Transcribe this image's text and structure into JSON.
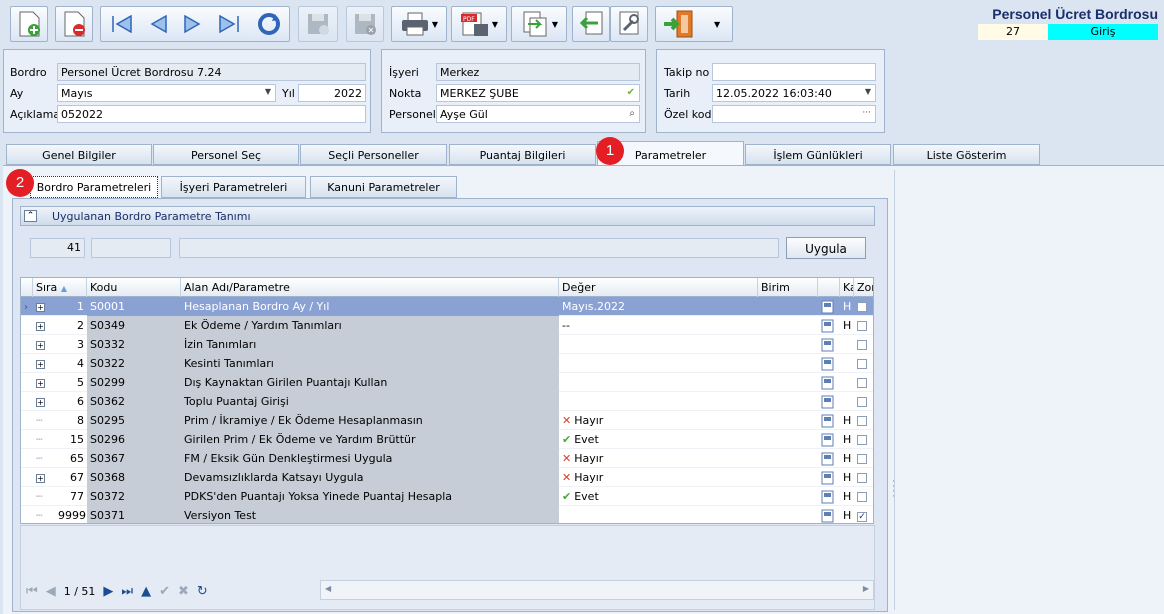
{
  "header": {
    "title": "Personel Ücret Bordrosu",
    "code": "27",
    "state": "Giriş"
  },
  "toolbar": {
    "buttons": [
      "new-icon",
      "delete-icon",
      "first-icon",
      "prev-icon",
      "next-icon",
      "last-icon",
      "refresh-icon",
      "save-icon",
      "cancel-save-icon",
      "print-icon",
      "pdf-icon",
      "export-icon",
      "import-icon",
      "tools-icon",
      "exit-icon"
    ]
  },
  "form": {
    "bordro_label": "Bordro",
    "bordro_value": "Personel Ücret Bordrosu 7.24",
    "ay_label": "Ay",
    "ay_value": "Mayıs",
    "yil_label": "Yıl",
    "yil_value": "2022",
    "aciklama_label": "Açıklama",
    "aciklama_value": "052022",
    "isyeri_label": "İşyeri",
    "isyeri_value": "Merkez",
    "nokta_label": "Nokta",
    "nokta_value": "MERKEZ ŞUBE",
    "personel_label": "Personel",
    "personel_value": "Ayşe Gül",
    "takip_label": "Takip no",
    "takip_value": "",
    "tarih_label": "Tarih",
    "tarih_value": "12.05.2022 16:03:40",
    "ozel_label": "Özel kod",
    "ozel_value": "",
    "ellipsis": "···"
  },
  "tabs": [
    "Genel Bilgiler",
    "Personel Seç",
    "Seçli Personeller",
    "Puantaj Bilgileri",
    "Parametreler",
    "İşlem Günlükleri",
    "Liste Gösterim"
  ],
  "subtabs": [
    "Bordro Parametreleri",
    "İşyeri Parametreleri",
    "Kanuni Parametreler"
  ],
  "badges": [
    "1",
    "2"
  ],
  "group": {
    "title": "Uygulanan Bordro Parametre Tanımı",
    "collapse": "⌃",
    "count": "41",
    "apply_label": "Uygula"
  },
  "grid": {
    "columns": {
      "sira": "Sıra",
      "kodu": "Kodu",
      "alan": "Alan Adı/Parametre",
      "deger": "Değer",
      "birim": "Birim",
      "ka": "Ka",
      "zo": "Zor"
    },
    "rows": [
      {
        "sira": "1",
        "kodu": "S0001",
        "alan": "Hesaplanan Bordro Ay / Yıl",
        "deger": "Mayıs.2022",
        "mark": "",
        "ka": "H",
        "zo": "",
        "plus": "+"
      },
      {
        "sira": "2",
        "kodu": "S0349",
        "alan": "Ek Ödeme / Yardım Tanımları",
        "deger": "--",
        "mark": "",
        "ka": "H",
        "zo": "",
        "plus": "+"
      },
      {
        "sira": "3",
        "kodu": "S0332",
        "alan": "İzin Tanımları",
        "deger": "",
        "mark": "",
        "ka": "",
        "zo": "",
        "plus": "+"
      },
      {
        "sira": "4",
        "kodu": "S0322",
        "alan": "Kesinti Tanımları",
        "deger": "",
        "mark": "",
        "ka": "",
        "zo": "",
        "plus": "+"
      },
      {
        "sira": "5",
        "kodu": "S0299",
        "alan": "Dış Kaynaktan Girilen Puantajı Kullan",
        "deger": "",
        "mark": "",
        "ka": "",
        "zo": "",
        "plus": "+"
      },
      {
        "sira": "6",
        "kodu": "S0362",
        "alan": "Toplu Puantaj Girişi",
        "deger": "",
        "mark": "",
        "ka": "",
        "zo": "",
        "plus": "+"
      },
      {
        "sira": "8",
        "kodu": "S0295",
        "alan": "Prim / İkramiye / Ek Ödeme Hesaplanmasın",
        "deger": "Hayır",
        "mark": "✕",
        "ka": "H",
        "zo": "",
        "plus": ""
      },
      {
        "sira": "15",
        "kodu": "S0296",
        "alan": "Girilen Prim /  Ek Ödeme ve Yardım Brüttür",
        "deger": "Evet",
        "mark": "✔",
        "ka": "H",
        "zo": "",
        "plus": ""
      },
      {
        "sira": "65",
        "kodu": "S0367",
        "alan": "FM / Eksik Gün Denkleştirmesi Uygula",
        "deger": "Hayır",
        "mark": "✕",
        "ka": "H",
        "zo": "",
        "plus": ""
      },
      {
        "sira": "67",
        "kodu": "S0368",
        "alan": "Devamsızlıklarda Katsayı Uygula",
        "deger": "Hayır",
        "mark": "✕",
        "ka": "H",
        "zo": "",
        "plus": "+"
      },
      {
        "sira": "77",
        "kodu": "S0372",
        "alan": "PDKS'den Puantajı Yoksa Yinede Puantaj Hesapla",
        "deger": "Evet",
        "mark": "✔",
        "ka": "H",
        "zo": "",
        "plus": ""
      },
      {
        "sira": "9999",
        "kodu": "S0371",
        "alan": "Versiyon Test",
        "deger": "",
        "mark": "",
        "ka": "H",
        "zo": "✓",
        "plus": ""
      }
    ]
  },
  "nav": {
    "page": "1 / 51"
  },
  "colors": {
    "selected_row": "#8aa1d4",
    "state_badge": "#00ffff",
    "title": "#1a2e6c"
  }
}
